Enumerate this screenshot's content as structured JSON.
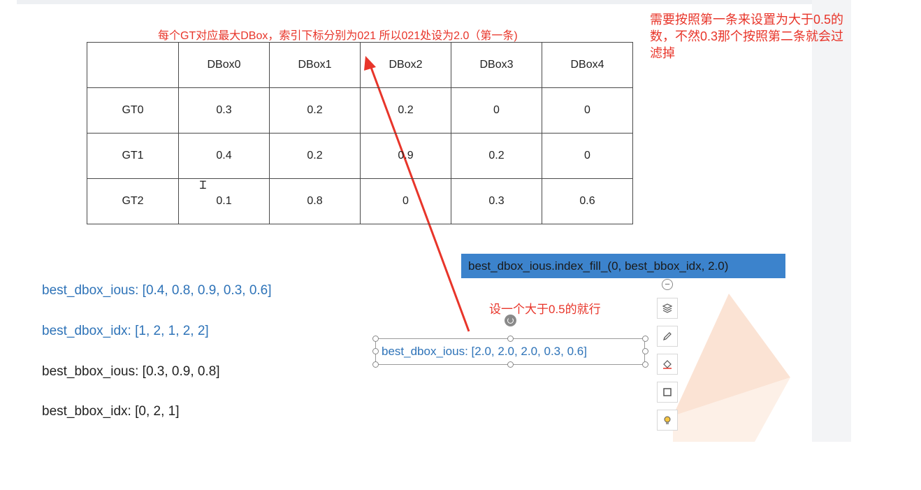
{
  "caption": "每个GT对应最大DBox，索引下标分别为021 所以021处设为2.0（第一条)",
  "note": "需要按照第一条来设置为大于0.5的数，不然0.3那个按照第二条就会过滤掉",
  "table": {
    "headers": [
      "",
      "DBox0",
      "DBox1",
      "DBox2",
      "DBox3",
      "DBox4"
    ],
    "rows": [
      {
        "label": "GT0",
        "values": [
          "0.3",
          "0.2",
          "0.2",
          "0",
          "0"
        ]
      },
      {
        "label": "GT1",
        "values": [
          "0.4",
          "0.2",
          "0.9",
          "0.2",
          "0"
        ]
      },
      {
        "label": "GT2",
        "values": [
          "0.1",
          "0.8",
          "0",
          "0.3",
          "0.6"
        ]
      }
    ]
  },
  "code": {
    "line1": "best_dbox_ious: [0.4,  0.8,   0.9,   0.3,   0.6]",
    "line2": "best_dbox_idx: [1,  2,  1,  2,  2]",
    "line3": "best_bbox_ious: [0.3,  0.9,  0.8]",
    "line4": "best_bbox_idx: [0,  2,  1]"
  },
  "blue_bar_text": "best_dbox_ious.index_fill_(0, best_bbox_idx, 2.0)",
  "small_note": "设一个大于0.5的就行",
  "selected_text": "best_dbox_ious: [2.0,  2.0,   2.0,   0.3,   0.6]",
  "colors": {
    "annotation_red": "#e8352a",
    "code_blue": "#2e73b8",
    "bar_blue": "#3c83cc",
    "shape_orange": "#fbe3d4"
  },
  "icons": [
    "minus-icon",
    "layers-icon",
    "pen-icon",
    "fill-icon",
    "frame-icon",
    "lightbulb-icon"
  ]
}
